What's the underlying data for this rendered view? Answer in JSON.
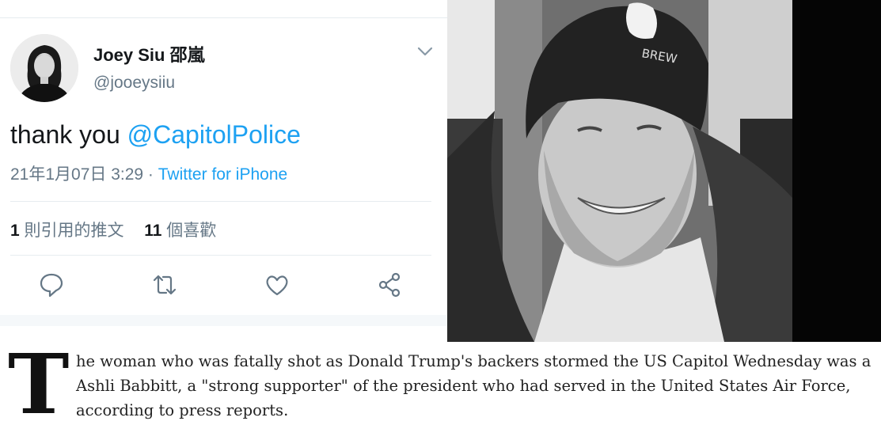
{
  "tweet": {
    "name": "Joey Siu 邵嵐",
    "handle": "@jooeysiiu",
    "text_prefix": "thank you ",
    "mention": "@CapitolPolice",
    "timestamp": "21年1月07日 3:29 · ",
    "source": "Twitter for iPhone",
    "quote_count": "1",
    "quote_label": " 則引用的推文",
    "like_count": "11",
    "like_label": " 個喜歡",
    "icons": [
      "reply-icon",
      "retweet-icon",
      "like-icon",
      "share-icon",
      "chevron-down-icon"
    ],
    "colors": {
      "link": "#1da1f2",
      "text": "#14171a",
      "muted": "#657786"
    }
  },
  "photo": {
    "cap_text": "BREW"
  },
  "article": {
    "drop_cap": "T",
    "paragraph": "he woman who was fatally shot as Donald Trump's backers stormed the US Capitol Wednesday was a Ashli Babbitt, a \"strong supporter\" of the president who had served in the United States Air Force, according to press reports."
  }
}
